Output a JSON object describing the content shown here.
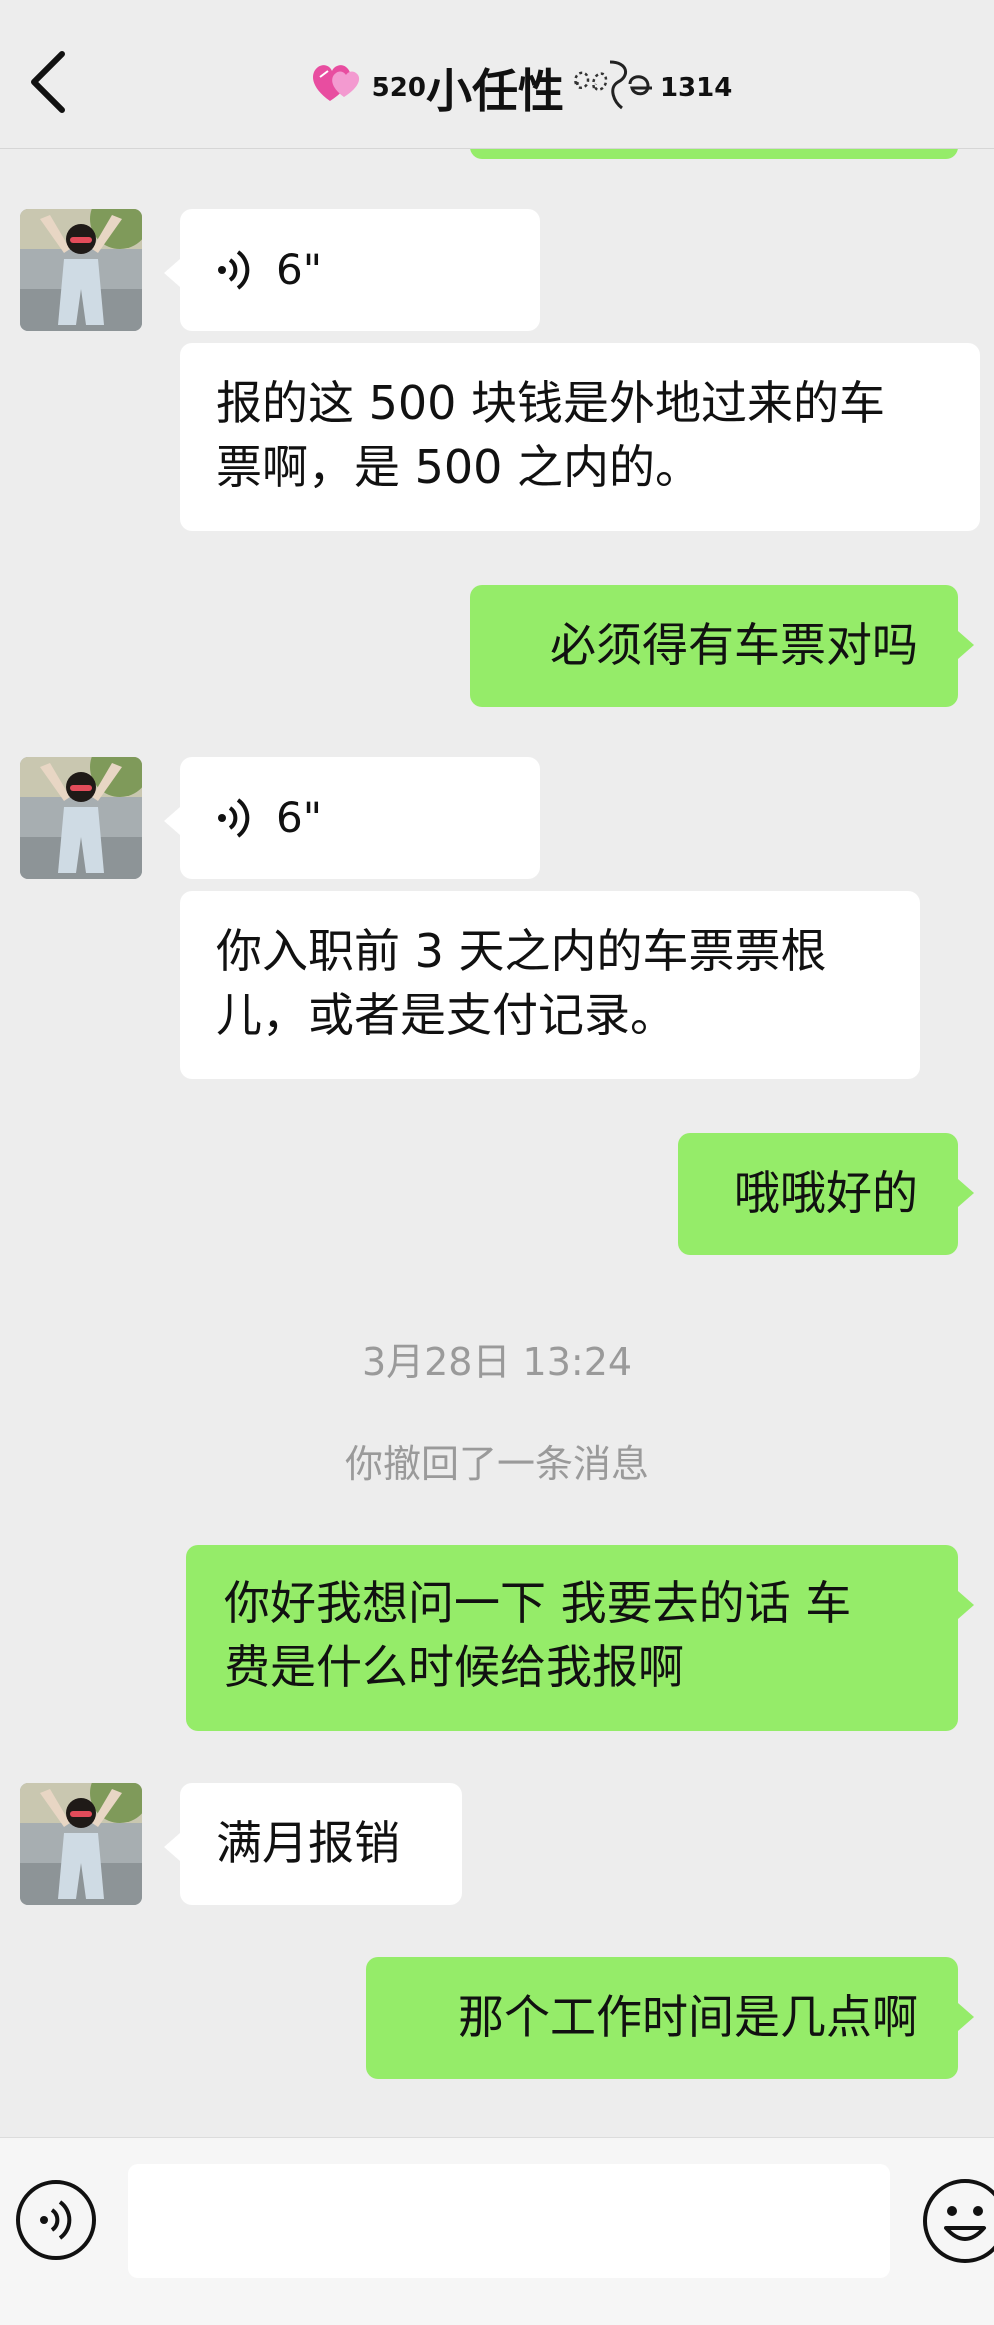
{
  "header": {
    "title_prefix_sub": "5",
    "title_prefix_sup": "20",
    "title_main": "小任性",
    "title_suffix_sup": "13",
    "title_suffix_sub": "14",
    "back_icon": "chevron-left-icon",
    "title_icon": "hearts-emoji-icon"
  },
  "messages": [
    {
      "kind": "voice",
      "side": "in",
      "duration": "6\""
    },
    {
      "kind": "text",
      "side": "in",
      "lines": [
        "报的这 500 块钱是外地过来的车",
        "票啊，是 500 之内的。"
      ]
    },
    {
      "kind": "text",
      "side": "out",
      "lines": [
        "必须得有车票对吗"
      ]
    },
    {
      "kind": "voice",
      "side": "in",
      "duration": "6\""
    },
    {
      "kind": "text",
      "side": "in",
      "lines": [
        "你入职前 3 天之内的车票票根",
        "儿，或者是支付记录。"
      ]
    },
    {
      "kind": "text",
      "side": "out",
      "lines": [
        "哦哦好的"
      ]
    },
    {
      "kind": "time",
      "text": "3月28日 13:24"
    },
    {
      "kind": "system",
      "text": "你撤回了一条消息"
    },
    {
      "kind": "text",
      "side": "out",
      "lines": [
        "你好我想问一下 我要去的话 车",
        "费是什么时候给我报啊"
      ]
    },
    {
      "kind": "text",
      "side": "in",
      "lines": [
        "满月报销"
      ]
    },
    {
      "kind": "text",
      "side": "out",
      "lines": [
        "那个工作时间是几点啊"
      ]
    }
  ],
  "input_bar": {
    "voice_icon": "voice-input-icon",
    "emoji_icon": "emoji-icon",
    "input_value": ""
  },
  "colors": {
    "background": "#ededed",
    "outgoing_bubble": "#95ec69",
    "incoming_bubble": "#ffffff",
    "system_text": "#9a9a9a"
  }
}
